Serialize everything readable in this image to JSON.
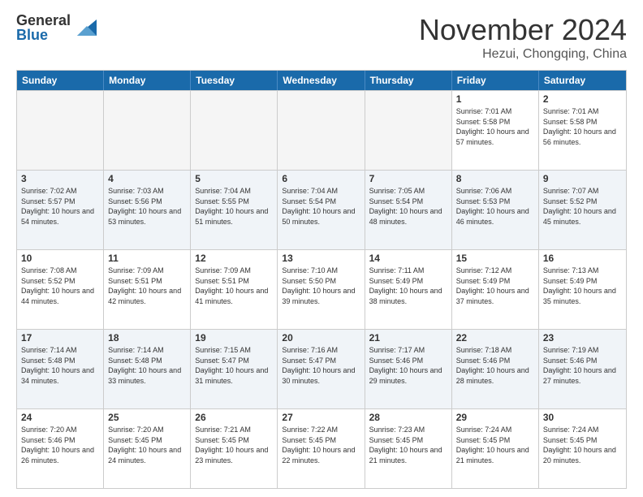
{
  "logo": {
    "general": "General",
    "blue": "Blue"
  },
  "title": "November 2024",
  "subtitle": "Hezui, Chongqing, China",
  "dayHeaders": [
    "Sunday",
    "Monday",
    "Tuesday",
    "Wednesday",
    "Thursday",
    "Friday",
    "Saturday"
  ],
  "weeks": [
    {
      "alt": false,
      "days": [
        {
          "num": "",
          "empty": true
        },
        {
          "num": "",
          "empty": true
        },
        {
          "num": "",
          "empty": true
        },
        {
          "num": "",
          "empty": true
        },
        {
          "num": "",
          "empty": true
        },
        {
          "num": "1",
          "sunrise": "7:01 AM",
          "sunset": "5:58 PM",
          "daylight": "10 hours and 57 minutes."
        },
        {
          "num": "2",
          "sunrise": "7:01 AM",
          "sunset": "5:58 PM",
          "daylight": "10 hours and 56 minutes."
        }
      ]
    },
    {
      "alt": true,
      "days": [
        {
          "num": "3",
          "sunrise": "7:02 AM",
          "sunset": "5:57 PM",
          "daylight": "10 hours and 54 minutes."
        },
        {
          "num": "4",
          "sunrise": "7:03 AM",
          "sunset": "5:56 PM",
          "daylight": "10 hours and 53 minutes."
        },
        {
          "num": "5",
          "sunrise": "7:04 AM",
          "sunset": "5:55 PM",
          "daylight": "10 hours and 51 minutes."
        },
        {
          "num": "6",
          "sunrise": "7:04 AM",
          "sunset": "5:54 PM",
          "daylight": "10 hours and 50 minutes."
        },
        {
          "num": "7",
          "sunrise": "7:05 AM",
          "sunset": "5:54 PM",
          "daylight": "10 hours and 48 minutes."
        },
        {
          "num": "8",
          "sunrise": "7:06 AM",
          "sunset": "5:53 PM",
          "daylight": "10 hours and 46 minutes."
        },
        {
          "num": "9",
          "sunrise": "7:07 AM",
          "sunset": "5:52 PM",
          "daylight": "10 hours and 45 minutes."
        }
      ]
    },
    {
      "alt": false,
      "days": [
        {
          "num": "10",
          "sunrise": "7:08 AM",
          "sunset": "5:52 PM",
          "daylight": "10 hours and 44 minutes."
        },
        {
          "num": "11",
          "sunrise": "7:09 AM",
          "sunset": "5:51 PM",
          "daylight": "10 hours and 42 minutes."
        },
        {
          "num": "12",
          "sunrise": "7:09 AM",
          "sunset": "5:51 PM",
          "daylight": "10 hours and 41 minutes."
        },
        {
          "num": "13",
          "sunrise": "7:10 AM",
          "sunset": "5:50 PM",
          "daylight": "10 hours and 39 minutes."
        },
        {
          "num": "14",
          "sunrise": "7:11 AM",
          "sunset": "5:49 PM",
          "daylight": "10 hours and 38 minutes."
        },
        {
          "num": "15",
          "sunrise": "7:12 AM",
          "sunset": "5:49 PM",
          "daylight": "10 hours and 37 minutes."
        },
        {
          "num": "16",
          "sunrise": "7:13 AM",
          "sunset": "5:49 PM",
          "daylight": "10 hours and 35 minutes."
        }
      ]
    },
    {
      "alt": true,
      "days": [
        {
          "num": "17",
          "sunrise": "7:14 AM",
          "sunset": "5:48 PM",
          "daylight": "10 hours and 34 minutes."
        },
        {
          "num": "18",
          "sunrise": "7:14 AM",
          "sunset": "5:48 PM",
          "daylight": "10 hours and 33 minutes."
        },
        {
          "num": "19",
          "sunrise": "7:15 AM",
          "sunset": "5:47 PM",
          "daylight": "10 hours and 31 minutes."
        },
        {
          "num": "20",
          "sunrise": "7:16 AM",
          "sunset": "5:47 PM",
          "daylight": "10 hours and 30 minutes."
        },
        {
          "num": "21",
          "sunrise": "7:17 AM",
          "sunset": "5:46 PM",
          "daylight": "10 hours and 29 minutes."
        },
        {
          "num": "22",
          "sunrise": "7:18 AM",
          "sunset": "5:46 PM",
          "daylight": "10 hours and 28 minutes."
        },
        {
          "num": "23",
          "sunrise": "7:19 AM",
          "sunset": "5:46 PM",
          "daylight": "10 hours and 27 minutes."
        }
      ]
    },
    {
      "alt": false,
      "days": [
        {
          "num": "24",
          "sunrise": "7:20 AM",
          "sunset": "5:46 PM",
          "daylight": "10 hours and 26 minutes."
        },
        {
          "num": "25",
          "sunrise": "7:20 AM",
          "sunset": "5:45 PM",
          "daylight": "10 hours and 24 minutes."
        },
        {
          "num": "26",
          "sunrise": "7:21 AM",
          "sunset": "5:45 PM",
          "daylight": "10 hours and 23 minutes."
        },
        {
          "num": "27",
          "sunrise": "7:22 AM",
          "sunset": "5:45 PM",
          "daylight": "10 hours and 22 minutes."
        },
        {
          "num": "28",
          "sunrise": "7:23 AM",
          "sunset": "5:45 PM",
          "daylight": "10 hours and 21 minutes."
        },
        {
          "num": "29",
          "sunrise": "7:24 AM",
          "sunset": "5:45 PM",
          "daylight": "10 hours and 21 minutes."
        },
        {
          "num": "30",
          "sunrise": "7:24 AM",
          "sunset": "5:45 PM",
          "daylight": "10 hours and 20 minutes."
        }
      ]
    }
  ]
}
